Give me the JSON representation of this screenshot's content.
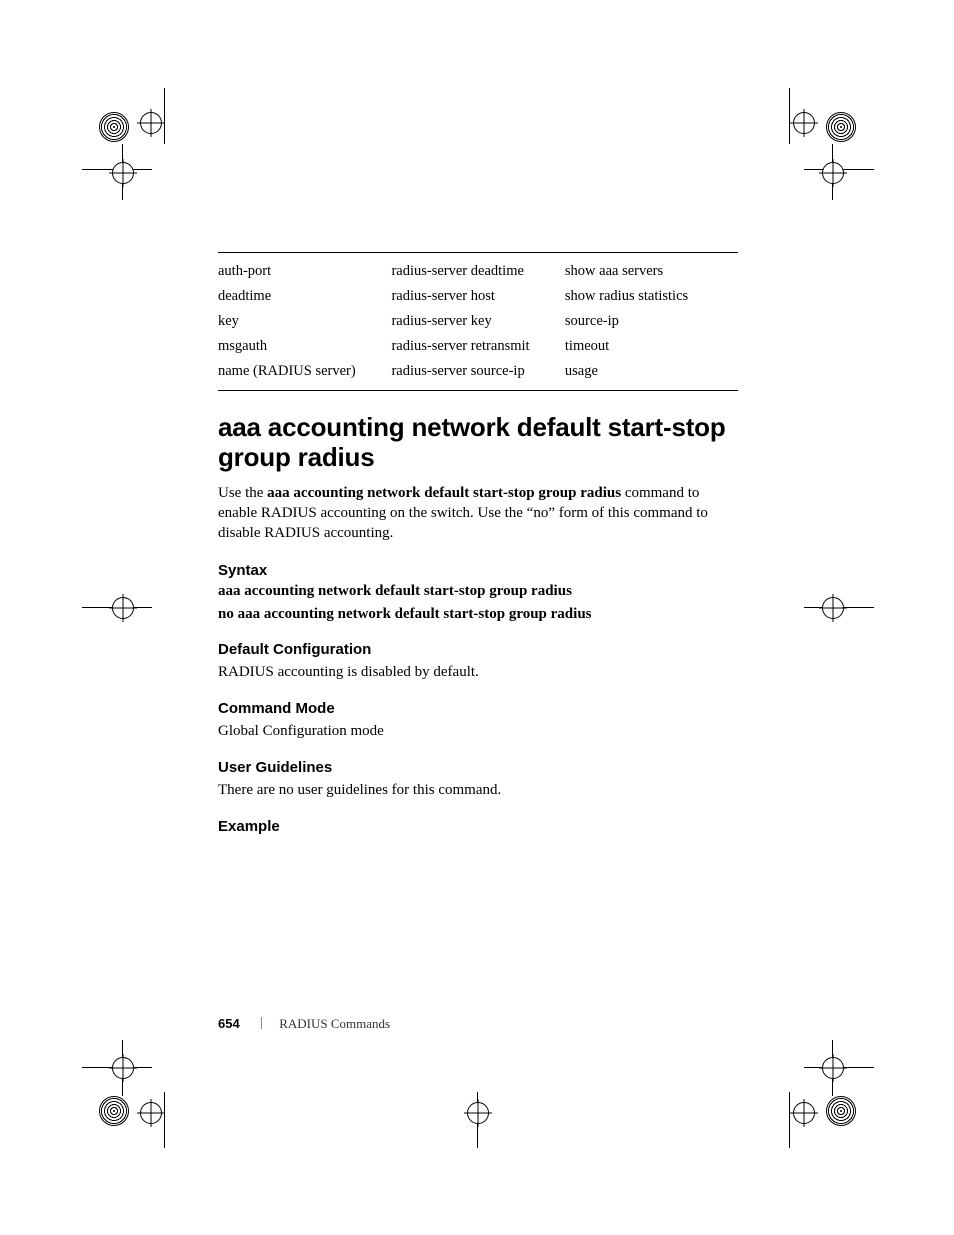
{
  "table": {
    "rows": [
      [
        "auth-port",
        "radius-server deadtime",
        "show aaa servers"
      ],
      [
        "deadtime",
        "radius-server host",
        "show radius statistics"
      ],
      [
        "key",
        "radius-server key",
        "source-ip"
      ],
      [
        "msgauth",
        "radius-server retransmit",
        "timeout"
      ],
      [
        "name (RADIUS server)",
        "radius-server source-ip",
        "usage"
      ]
    ]
  },
  "heading": "aaa accounting network default start-stop group radius",
  "intro": {
    "prefix": "Use the ",
    "bold": "aaa accounting network default start-stop group radius",
    "suffix": " command to enable RADIUS accounting on the switch. Use the “no” form of this command to disable RADIUS accounting."
  },
  "sections": {
    "syntax_label": "Syntax",
    "syntax_line1": "aaa accounting network default start-stop group radius",
    "syntax_line2": "no aaa accounting network default start-stop group radius",
    "default_label": "Default Configuration",
    "default_body": "RADIUS accounting is disabled by default.",
    "mode_label": "Command Mode",
    "mode_body": "Global Configuration mode",
    "guidelines_label": "User Guidelines",
    "guidelines_body": "There are no user guidelines for this command.",
    "example_label": "Example"
  },
  "footer": {
    "page": "654",
    "section": "RADIUS Commands"
  }
}
